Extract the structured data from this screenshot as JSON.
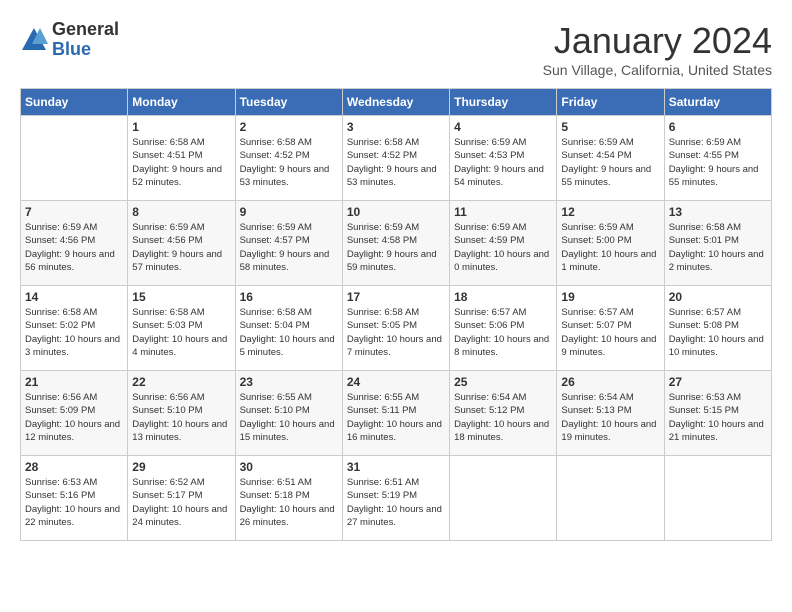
{
  "logo": {
    "general": "General",
    "blue": "Blue"
  },
  "title": "January 2024",
  "subtitle": "Sun Village, California, United States",
  "headers": [
    "Sunday",
    "Monday",
    "Tuesday",
    "Wednesday",
    "Thursday",
    "Friday",
    "Saturday"
  ],
  "weeks": [
    [
      {
        "day": "",
        "sunrise": "",
        "sunset": "",
        "daylight": ""
      },
      {
        "day": "1",
        "sunrise": "Sunrise: 6:58 AM",
        "sunset": "Sunset: 4:51 PM",
        "daylight": "Daylight: 9 hours and 52 minutes."
      },
      {
        "day": "2",
        "sunrise": "Sunrise: 6:58 AM",
        "sunset": "Sunset: 4:52 PM",
        "daylight": "Daylight: 9 hours and 53 minutes."
      },
      {
        "day": "3",
        "sunrise": "Sunrise: 6:58 AM",
        "sunset": "Sunset: 4:52 PM",
        "daylight": "Daylight: 9 hours and 53 minutes."
      },
      {
        "day": "4",
        "sunrise": "Sunrise: 6:59 AM",
        "sunset": "Sunset: 4:53 PM",
        "daylight": "Daylight: 9 hours and 54 minutes."
      },
      {
        "day": "5",
        "sunrise": "Sunrise: 6:59 AM",
        "sunset": "Sunset: 4:54 PM",
        "daylight": "Daylight: 9 hours and 55 minutes."
      },
      {
        "day": "6",
        "sunrise": "Sunrise: 6:59 AM",
        "sunset": "Sunset: 4:55 PM",
        "daylight": "Daylight: 9 hours and 55 minutes."
      }
    ],
    [
      {
        "day": "7",
        "sunrise": "Sunrise: 6:59 AM",
        "sunset": "Sunset: 4:56 PM",
        "daylight": "Daylight: 9 hours and 56 minutes."
      },
      {
        "day": "8",
        "sunrise": "Sunrise: 6:59 AM",
        "sunset": "Sunset: 4:56 PM",
        "daylight": "Daylight: 9 hours and 57 minutes."
      },
      {
        "day": "9",
        "sunrise": "Sunrise: 6:59 AM",
        "sunset": "Sunset: 4:57 PM",
        "daylight": "Daylight: 9 hours and 58 minutes."
      },
      {
        "day": "10",
        "sunrise": "Sunrise: 6:59 AM",
        "sunset": "Sunset: 4:58 PM",
        "daylight": "Daylight: 9 hours and 59 minutes."
      },
      {
        "day": "11",
        "sunrise": "Sunrise: 6:59 AM",
        "sunset": "Sunset: 4:59 PM",
        "daylight": "Daylight: 10 hours and 0 minutes."
      },
      {
        "day": "12",
        "sunrise": "Sunrise: 6:59 AM",
        "sunset": "Sunset: 5:00 PM",
        "daylight": "Daylight: 10 hours and 1 minute."
      },
      {
        "day": "13",
        "sunrise": "Sunrise: 6:58 AM",
        "sunset": "Sunset: 5:01 PM",
        "daylight": "Daylight: 10 hours and 2 minutes."
      }
    ],
    [
      {
        "day": "14",
        "sunrise": "Sunrise: 6:58 AM",
        "sunset": "Sunset: 5:02 PM",
        "daylight": "Daylight: 10 hours and 3 minutes."
      },
      {
        "day": "15",
        "sunrise": "Sunrise: 6:58 AM",
        "sunset": "Sunset: 5:03 PM",
        "daylight": "Daylight: 10 hours and 4 minutes."
      },
      {
        "day": "16",
        "sunrise": "Sunrise: 6:58 AM",
        "sunset": "Sunset: 5:04 PM",
        "daylight": "Daylight: 10 hours and 5 minutes."
      },
      {
        "day": "17",
        "sunrise": "Sunrise: 6:58 AM",
        "sunset": "Sunset: 5:05 PM",
        "daylight": "Daylight: 10 hours and 7 minutes."
      },
      {
        "day": "18",
        "sunrise": "Sunrise: 6:57 AM",
        "sunset": "Sunset: 5:06 PM",
        "daylight": "Daylight: 10 hours and 8 minutes."
      },
      {
        "day": "19",
        "sunrise": "Sunrise: 6:57 AM",
        "sunset": "Sunset: 5:07 PM",
        "daylight": "Daylight: 10 hours and 9 minutes."
      },
      {
        "day": "20",
        "sunrise": "Sunrise: 6:57 AM",
        "sunset": "Sunset: 5:08 PM",
        "daylight": "Daylight: 10 hours and 10 minutes."
      }
    ],
    [
      {
        "day": "21",
        "sunrise": "Sunrise: 6:56 AM",
        "sunset": "Sunset: 5:09 PM",
        "daylight": "Daylight: 10 hours and 12 minutes."
      },
      {
        "day": "22",
        "sunrise": "Sunrise: 6:56 AM",
        "sunset": "Sunset: 5:10 PM",
        "daylight": "Daylight: 10 hours and 13 minutes."
      },
      {
        "day": "23",
        "sunrise": "Sunrise: 6:55 AM",
        "sunset": "Sunset: 5:10 PM",
        "daylight": "Daylight: 10 hours and 15 minutes."
      },
      {
        "day": "24",
        "sunrise": "Sunrise: 6:55 AM",
        "sunset": "Sunset: 5:11 PM",
        "daylight": "Daylight: 10 hours and 16 minutes."
      },
      {
        "day": "25",
        "sunrise": "Sunrise: 6:54 AM",
        "sunset": "Sunset: 5:12 PM",
        "daylight": "Daylight: 10 hours and 18 minutes."
      },
      {
        "day": "26",
        "sunrise": "Sunrise: 6:54 AM",
        "sunset": "Sunset: 5:13 PM",
        "daylight": "Daylight: 10 hours and 19 minutes."
      },
      {
        "day": "27",
        "sunrise": "Sunrise: 6:53 AM",
        "sunset": "Sunset: 5:15 PM",
        "daylight": "Daylight: 10 hours and 21 minutes."
      }
    ],
    [
      {
        "day": "28",
        "sunrise": "Sunrise: 6:53 AM",
        "sunset": "Sunset: 5:16 PM",
        "daylight": "Daylight: 10 hours and 22 minutes."
      },
      {
        "day": "29",
        "sunrise": "Sunrise: 6:52 AM",
        "sunset": "Sunset: 5:17 PM",
        "daylight": "Daylight: 10 hours and 24 minutes."
      },
      {
        "day": "30",
        "sunrise": "Sunrise: 6:51 AM",
        "sunset": "Sunset: 5:18 PM",
        "daylight": "Daylight: 10 hours and 26 minutes."
      },
      {
        "day": "31",
        "sunrise": "Sunrise: 6:51 AM",
        "sunset": "Sunset: 5:19 PM",
        "daylight": "Daylight: 10 hours and 27 minutes."
      },
      {
        "day": "",
        "sunrise": "",
        "sunset": "",
        "daylight": ""
      },
      {
        "day": "",
        "sunrise": "",
        "sunset": "",
        "daylight": ""
      },
      {
        "day": "",
        "sunrise": "",
        "sunset": "",
        "daylight": ""
      }
    ]
  ]
}
